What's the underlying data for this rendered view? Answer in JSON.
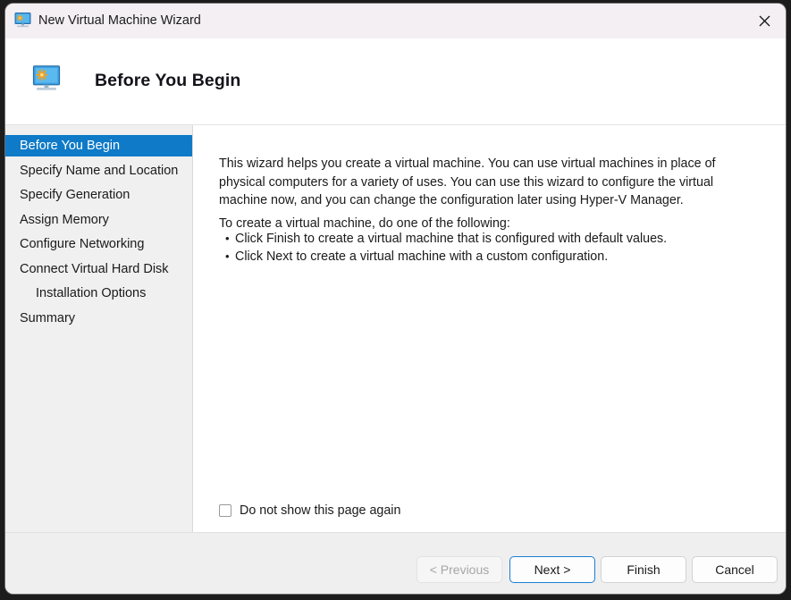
{
  "window": {
    "title": "New Virtual Machine Wizard",
    "title_icon": "virtual-machine-monitor-icon",
    "close_icon": "close-icon",
    "accent_color": "#0f7ac7",
    "titlebar_color": "#f4eff3"
  },
  "header": {
    "icon": "virtual-machine-monitor-icon",
    "title": "Before You Begin"
  },
  "sidebar": {
    "items": [
      {
        "label": "Before You Begin",
        "selected": true,
        "indent": false
      },
      {
        "label": "Specify Name and Location",
        "selected": false,
        "indent": false
      },
      {
        "label": "Specify Generation",
        "selected": false,
        "indent": false
      },
      {
        "label": "Assign Memory",
        "selected": false,
        "indent": false
      },
      {
        "label": "Configure Networking",
        "selected": false,
        "indent": false
      },
      {
        "label": "Connect Virtual Hard Disk",
        "selected": false,
        "indent": false
      },
      {
        "label": "Installation Options",
        "selected": false,
        "indent": true
      },
      {
        "label": "Summary",
        "selected": false,
        "indent": false
      }
    ]
  },
  "content": {
    "paragraph1": "This wizard helps you create a virtual machine. You can use virtual machines in place of physical computers for a variety of uses. You can use this wizard to configure the virtual machine now, and you can change the configuration later using Hyper-V Manager.",
    "paragraph2": "To create a virtual machine, do one of the following:",
    "bullets": [
      "Click Finish to create a virtual machine that is configured with default values.",
      "Click Next to create a virtual machine with a custom configuration."
    ],
    "checkbox": {
      "label": "Do not show this page again",
      "checked": false
    }
  },
  "footer": {
    "buttons": [
      {
        "label": "< Previous",
        "state": "disabled"
      },
      {
        "label": "Next >",
        "state": "focused"
      },
      {
        "label": "Finish",
        "state": "normal"
      },
      {
        "label": "Cancel",
        "state": "normal"
      }
    ]
  }
}
